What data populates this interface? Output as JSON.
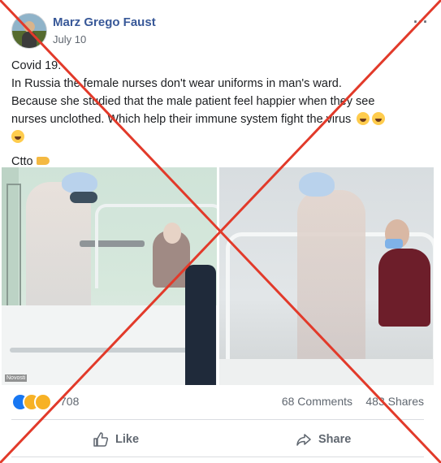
{
  "post": {
    "author": "Marz Grego Faust",
    "date": "July 10",
    "more_icon": "...",
    "text_lines": [
      "Covid 19:",
      "In Russia the female nurses don't wear uniforms in man's ward.",
      "Because she studied that the male patient feel happier when they see",
      "nurses unclothed. Which help their immune system fight the virus"
    ],
    "ctto": "Ctto"
  },
  "photos": {
    "left_watermark": "Novosti"
  },
  "stats": {
    "reaction_count": "708",
    "comments": "68 Comments",
    "shares": "483 Shares"
  },
  "actions": {
    "like_label": "Like",
    "share_label": "Share"
  },
  "colors": {
    "author_link": "#385898",
    "cross_red": "#e23a2a",
    "like_blue": "#1877f2",
    "muted_text": "#606770"
  }
}
